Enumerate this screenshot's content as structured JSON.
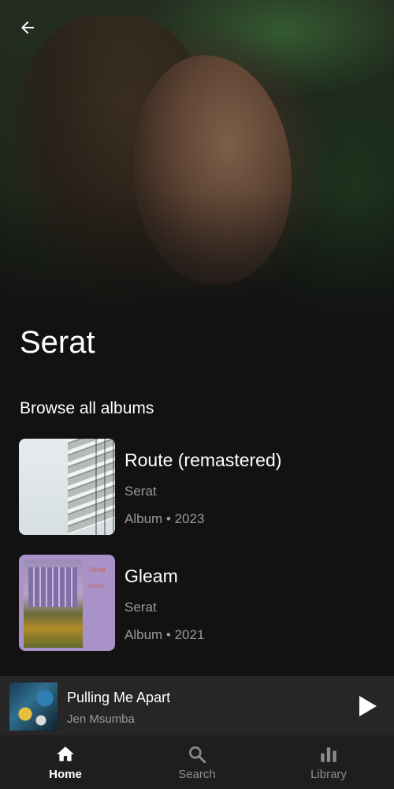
{
  "artist": {
    "name": "Serat"
  },
  "section": {
    "title": "Browse all albums"
  },
  "albums": [
    {
      "title": "Route (remastered)",
      "artist": "Serat",
      "meta": "Album • 2023",
      "cover_icon": "building-cover"
    },
    {
      "title": "Gleam",
      "artist": "Serat",
      "meta": "Album • 2021",
      "cover_icon": "purple-cover",
      "cover_text": [
        "Serat",
        "Gleam"
      ]
    }
  ],
  "now_playing": {
    "song": "Pulling Me Apart",
    "artist": "Jen Msumba"
  },
  "bottom_nav": {
    "items": [
      {
        "label": "Home",
        "icon": "home-icon",
        "active": true
      },
      {
        "label": "Search",
        "icon": "search-icon",
        "active": false
      },
      {
        "label": "Library",
        "icon": "library-icon",
        "active": false
      }
    ]
  },
  "colors": {
    "background": "#121212",
    "secondary_text": "#9a9a9a",
    "mini_player_bg": "#262626",
    "nav_bg": "#1e1e1e"
  }
}
